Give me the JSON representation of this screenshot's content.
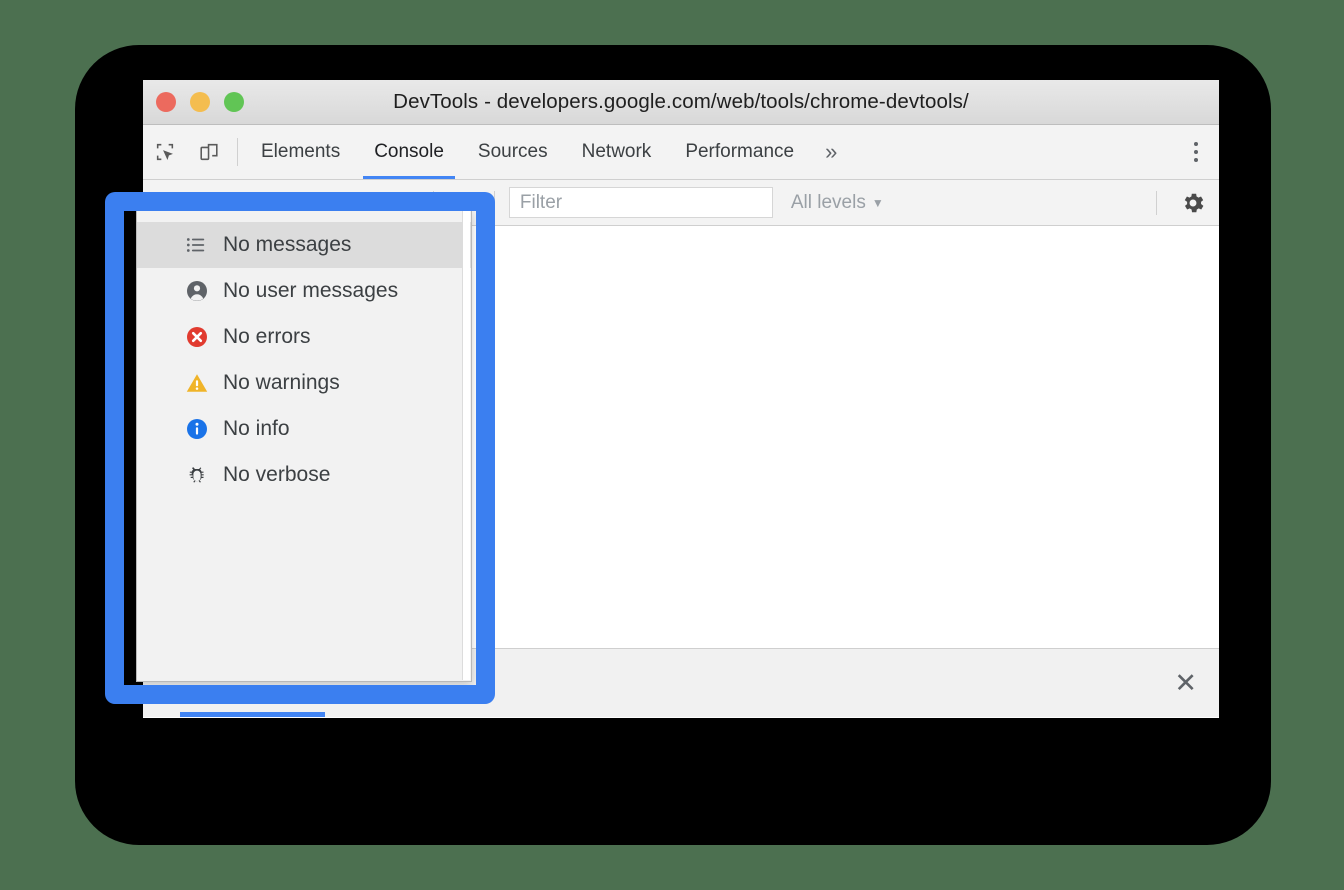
{
  "window": {
    "title": "DevTools - developers.google.com/web/tools/chrome-devtools/",
    "traffic_lights": [
      {
        "name": "close",
        "color": "#ec6a5e"
      },
      {
        "name": "minimize",
        "color": "#f4bd4f"
      },
      {
        "name": "zoom",
        "color": "#61c555"
      }
    ]
  },
  "tabstrip": {
    "left_icons": [
      {
        "name": "inspect-element-icon",
        "glyph": "inspect"
      },
      {
        "name": "device-toolbar-icon",
        "glyph": "device"
      }
    ],
    "tabs": [
      {
        "label": "Elements",
        "active": false
      },
      {
        "label": "Console",
        "active": true
      },
      {
        "label": "Sources",
        "active": false
      },
      {
        "label": "Network",
        "active": false
      },
      {
        "label": "Performance",
        "active": false
      }
    ],
    "more_tabs_label": "»",
    "menu_icon": "kebab-menu-icon",
    "active_tab_color": "#4285f4"
  },
  "console_toolbar": {
    "context_caret": "▼",
    "eye_icon": "live-expression-eye-icon",
    "filter": {
      "value": "",
      "placeholder": "Filter"
    },
    "levels": {
      "label": "All levels",
      "caret": "▼"
    },
    "settings_icon": "gear-icon"
  },
  "console_body": {
    "prompt_caret": true,
    "messages": []
  },
  "log_levels_dropdown": {
    "items": [
      {
        "label": "No messages",
        "icon": "list-icon",
        "icon_color": "#5f6368",
        "highlighted": true
      },
      {
        "label": "No user messages",
        "icon": "person-icon",
        "icon_color": "#5f6368",
        "highlighted": false
      },
      {
        "label": "No errors",
        "icon": "error-icon",
        "icon_color": "#e13b2f",
        "highlighted": false
      },
      {
        "label": "No warnings",
        "icon": "warning-icon",
        "icon_color": "#f0b429",
        "highlighted": false
      },
      {
        "label": "No info",
        "icon": "info-icon",
        "icon_color": "#1a73e8",
        "highlighted": false
      },
      {
        "label": "No verbose",
        "icon": "bug-icon",
        "icon_color": "#3c4043",
        "highlighted": false
      }
    ]
  },
  "drawer": {
    "close_label": "✕",
    "accent_color": "#4285f4"
  },
  "callout": {
    "color": "#3b7ff0"
  }
}
